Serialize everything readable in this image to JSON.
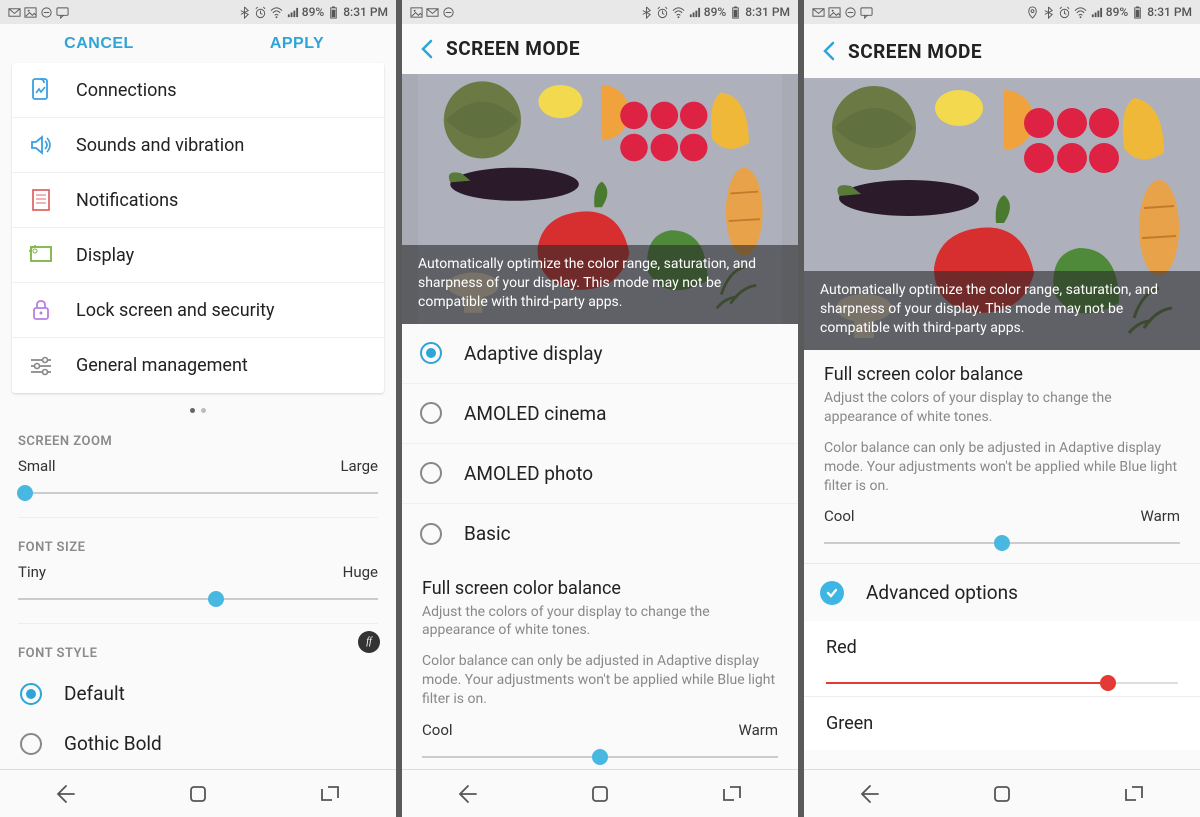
{
  "status": {
    "battery_text": "89%",
    "time": "8:31 PM"
  },
  "screen1": {
    "cancel": "CANCEL",
    "apply": "APPLY",
    "rows": [
      {
        "label": "Connections",
        "icon": "connections-icon",
        "color": "#3b9fe0"
      },
      {
        "label": "Sounds and vibration",
        "icon": "sound-icon",
        "color": "#3b9fe0"
      },
      {
        "label": "Notifications",
        "icon": "notifications-icon",
        "color": "#e06a6a"
      },
      {
        "label": "Display",
        "icon": "display-icon",
        "color": "#7cb342"
      },
      {
        "label": "Lock screen and security",
        "icon": "lock-icon",
        "color": "#ba7fe0"
      },
      {
        "label": "General management",
        "icon": "general-icon",
        "color": "#888"
      }
    ],
    "screen_zoom": {
      "heading": "SCREEN ZOOM",
      "min": "Small",
      "max": "Large",
      "value": 0
    },
    "font_size": {
      "heading": "FONT SIZE",
      "min": "Tiny",
      "max": "Huge",
      "value": 55
    },
    "font_style": {
      "heading": "FONT STYLE",
      "options": [
        {
          "label": "Default",
          "selected": true
        },
        {
          "label": "Gothic Bold",
          "selected": false
        }
      ]
    }
  },
  "screen2": {
    "title": "SCREEN MODE",
    "caption": "Automatically optimize the color range, saturation, and sharpness of your display. This mode may not be compatible with third-party apps.",
    "modes": [
      {
        "label": "Adaptive display",
        "selected": true
      },
      {
        "label": "AMOLED cinema",
        "selected": false
      },
      {
        "label": "AMOLED photo",
        "selected": false
      },
      {
        "label": "Basic",
        "selected": false
      }
    ],
    "fscb_title": "Full screen color balance",
    "fscb_sub": "Adjust the colors of your display to change the appearance of white tones.",
    "fscb_note": "Color balance can only be adjusted in Adaptive display mode. Your adjustments won't be applied while Blue light filter is on.",
    "cool": "Cool",
    "warm": "Warm",
    "balance": 50
  },
  "screen3": {
    "title": "SCREEN MODE",
    "caption": "Automatically optimize the color range, saturation, and sharpness of your display. This mode may not be compatible with third-party apps.",
    "fscb_title": "Full screen color balance",
    "fscb_sub": "Adjust the colors of your display to change the appearance of white tones.",
    "fscb_note": "Color balance can only be adjusted in Adaptive display mode. Your adjustments won't be applied while Blue light filter is on.",
    "cool": "Cool",
    "warm": "Warm",
    "balance": 50,
    "advanced_label": "Advanced options",
    "advanced_checked": true,
    "red": {
      "label": "Red",
      "value": 80,
      "color": "#e53935"
    },
    "green": {
      "label": "Green"
    }
  }
}
